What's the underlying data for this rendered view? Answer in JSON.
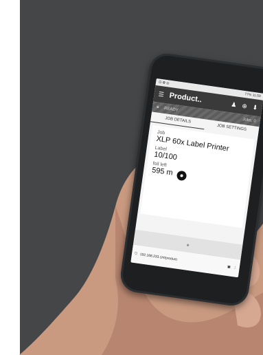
{
  "screen": {
    "status_time": "11:59",
    "status_battery": "77%",
    "app_title": "Product..",
    "printer_status": "READY",
    "jobs_label": "Jobs: 0",
    "tabs": [
      {
        "label": "JOB DETAILS"
      },
      {
        "label": "JOB SETTINGS"
      }
    ],
    "job_label": "Job",
    "job_value": "XLP 60x Label Printer",
    "label_label": "Label",
    "label_value": "10/100",
    "foil_label": "foil left",
    "foil_value": "595 m",
    "url": "192.168.233.1/#/product:"
  },
  "icons": {
    "menu": "menu-icon",
    "user": "user-icon",
    "globe": "globe-icon",
    "download": "download-icon",
    "lock": "lock-icon"
  }
}
